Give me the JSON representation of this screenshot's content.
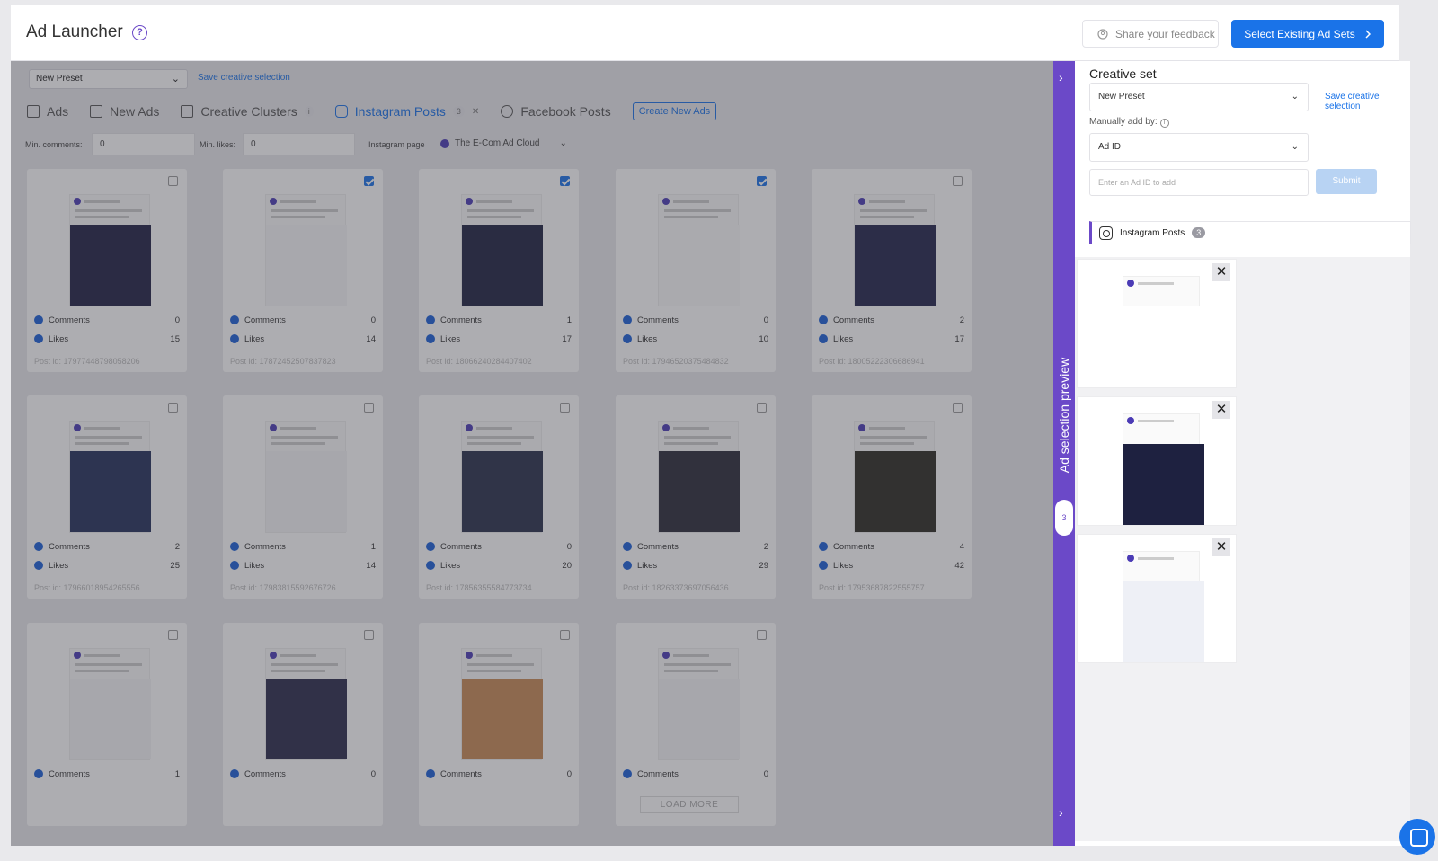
{
  "header": {
    "title": "Ad Launcher",
    "help_icon": "?",
    "feedback_label": "Share your feedback",
    "select_existing_label": "Select Existing Ad Sets"
  },
  "toolbar": {
    "preset": "New Preset",
    "save_link": "Save creative selection"
  },
  "tabs": [
    {
      "label": "Ads",
      "icon": "ads-icon"
    },
    {
      "label": "New Ads",
      "icon": "new-ads-icon"
    },
    {
      "label": "Creative Clusters",
      "icon": "image-icon"
    },
    {
      "label": "Instagram Posts",
      "icon": "instagram-icon",
      "badge": "3"
    },
    {
      "label": "Facebook Posts",
      "icon": "facebook-icon"
    }
  ],
  "create_new_ads": "Create New Ads",
  "filters": {
    "min_comments_label": "Min. comments:",
    "min_comments_value": "0",
    "min_likes_label": "Min. likes:",
    "min_likes_value": "0",
    "page_label": "Instagram page",
    "page_value": "The E-Com Ad Cloud"
  },
  "stats_labels": {
    "comments": "Comments",
    "likes": "Likes"
  },
  "posts": [
    {
      "comments": "0",
      "likes": "15",
      "post_id": "Post id: 17977448798058206",
      "checked": false
    },
    {
      "comments": "0",
      "likes": "14",
      "post_id": "Post id: 17872452507837823",
      "checked": true
    },
    {
      "comments": "1",
      "likes": "17",
      "post_id": "Post id: 18066240284407402",
      "checked": true
    },
    {
      "comments": "0",
      "likes": "10",
      "post_id": "Post id: 17946520375484832",
      "checked": true
    },
    {
      "comments": "2",
      "likes": "17",
      "post_id": "Post id: 18005222306686941",
      "checked": false
    },
    {
      "comments": "2",
      "likes": "25",
      "post_id": "Post id: 17966018954265556",
      "checked": false
    },
    {
      "comments": "1",
      "likes": "14",
      "post_id": "Post id: 17983815592676726",
      "checked": false
    },
    {
      "comments": "0",
      "likes": "20",
      "post_id": "Post id: 17856355584773734",
      "checked": false
    },
    {
      "comments": "2",
      "likes": "29",
      "post_id": "Post id: 18263373697056436",
      "checked": false
    },
    {
      "comments": "4",
      "likes": "42",
      "post_id": "Post id: 17953687822555757",
      "checked": false
    },
    {
      "comments": "1",
      "checked": false
    },
    {
      "comments": "0",
      "checked": false
    },
    {
      "comments": "0",
      "checked": false
    },
    {
      "comments": "0",
      "checked": false
    }
  ],
  "load_more": "LOAD MORE",
  "panel": {
    "strip_label": "Ad selection preview",
    "strip_count": "3",
    "title": "Creative set",
    "preset": "New Preset",
    "save_link": "Save creative selection",
    "manually_add_label": "Manually add by:",
    "add_by_value": "Ad ID",
    "ad_id_placeholder": "Enter an Ad ID to add",
    "submit_label": "Submit",
    "section_label": "Instagram Posts",
    "section_count": "3",
    "close_glyph": "✕"
  },
  "colors": {
    "accent": "#1a73e8",
    "purple": "#6b49c8"
  }
}
